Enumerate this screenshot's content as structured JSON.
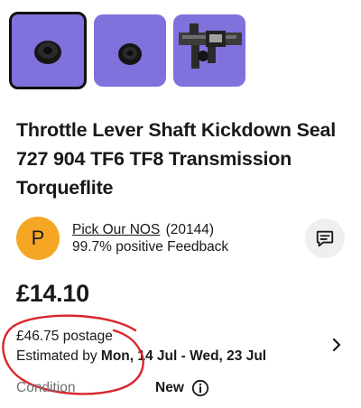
{
  "thumbnails": [
    {
      "depicts": "seal-front",
      "selected": true
    },
    {
      "depicts": "seal-side",
      "selected": false
    },
    {
      "depicts": "seal-with-caliper",
      "selected": false
    }
  ],
  "colors": {
    "thumb_bg": "#7f72dd",
    "avatar_bg": "#f5a623",
    "annotation_red": "#d9262c"
  },
  "listing": {
    "title": "Throttle Lever Shaft Kickdown Seal 727 904 TF6 TF8 Transmission Torqueflite",
    "price": "£14.10"
  },
  "seller": {
    "avatar_letter": "P",
    "name": "Pick Our NOS",
    "count": "(20144)",
    "feedback": "99.7% positive Feedback"
  },
  "postage": {
    "cost": "£46.75 postage",
    "estimated_prefix": "Estimated by",
    "estimated_dates": "Mon, 14 Jul - Wed, 23 Jul"
  },
  "condition": {
    "label": "Condition",
    "value": "New"
  }
}
